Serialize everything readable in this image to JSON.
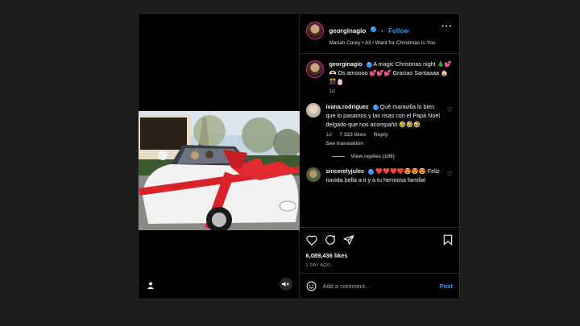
{
  "post": {
    "author": "georginagio",
    "follow_label": "Follow",
    "dot": "•",
    "audio": "Mariah Carey • All I Want for Christmas Is You",
    "more": "···"
  },
  "caption": {
    "author": "georginagio",
    "text": "A magic Christmas night 🎄💕🫶🏻 Os amoooo 💕💕💕 Gracias Santaaaa 🏠🎊🎅🏻",
    "time": "1d"
  },
  "comments": [
    {
      "author": "ivana.rodriguez",
      "text": "Qué maravilla lo bien que lo pasamos y las risas con el Papá Noel delgado que nos acompañó 🤣🤣🤣",
      "time": "1d",
      "likes": "7 323 likes",
      "reply": "Reply",
      "see_translation": "See translation",
      "view_replies": "View replies (106)"
    },
    {
      "author": "sincerelyjules",
      "text": "❤️❤️❤️❤️😍😍😍 Feliz navida bella a ti y a tu hermosa familia!"
    }
  ],
  "engagement": {
    "likes": "6,089,436 likes",
    "date": "1 DAY AGO"
  },
  "add_comment": {
    "placeholder": "Add a comment...",
    "post_label": "Post"
  },
  "colors": {
    "accent": "#3897f0",
    "background": "#000000",
    "page": "#1c1c1c",
    "ribbon": "#d8232a"
  },
  "icons": [
    "user-tag-icon",
    "mute-icon",
    "more-icon",
    "heart-icon",
    "comment-icon",
    "share-icon",
    "save-icon",
    "emoji-icon",
    "verified-icon"
  ]
}
